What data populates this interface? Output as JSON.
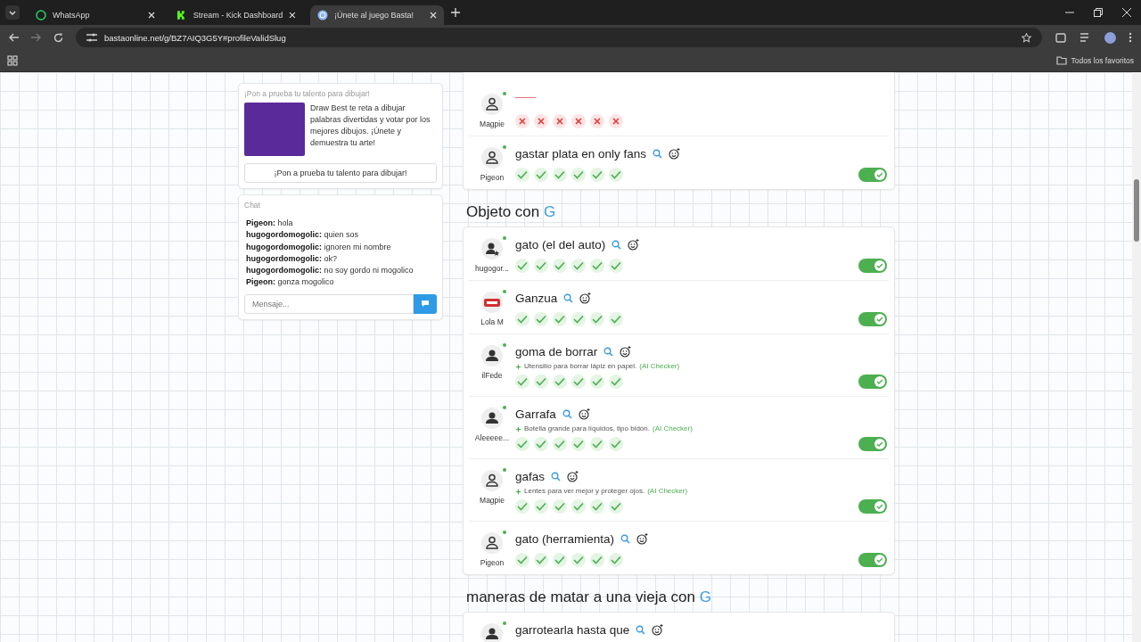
{
  "browser": {
    "tabs": [
      {
        "title": "WhatsApp",
        "kind": "chat",
        "selected": false
      },
      {
        "title": "Stream - Kick Dashboard",
        "kind": "letter",
        "selected": false
      },
      {
        "title": "¡Únete al juego Basta!",
        "kind": "globe",
        "selected": true
      }
    ],
    "url": "bastaonline.net/g/BZ7AIQ3G5Y#profileValidSlug",
    "bookmarks_label": "Todos los favoritos"
  },
  "promo": {
    "heading": "¡Pon a prueba tu talento para dibujar!",
    "text": "Draw Best te reta a dibujar palabras divertidas y votar por los mejores dibujos. ¡Únete y demuestra tu arte!",
    "button": "¡Pon a prueba tu talento para dibujar!"
  },
  "chat": {
    "title": "Chat",
    "messages": [
      {
        "user": "Pigeon:",
        "text": "hola"
      },
      {
        "user": "hugogordomogolic:",
        "text": "quien sos"
      },
      {
        "user": "hugogordomogolic:",
        "text": "ignoren mi nombre"
      },
      {
        "user": "hugogordomogolic:",
        "text": "ok?"
      },
      {
        "user": "hugogordomogolic:",
        "text": "no soy gordo ni mogolico"
      },
      {
        "user": "Pigeon:",
        "text": "gonza mogolico"
      }
    ],
    "placeholder": "Mensaje..."
  },
  "sections": [
    {
      "answers": [
        {
          "user": "Magpie",
          "kind": "outline",
          "votes": [
            false,
            false,
            false,
            false,
            false,
            false
          ]
        },
        {
          "user": "Pigeon",
          "kind": "outline",
          "answer": "gastar plata en only fans",
          "votes": [
            true,
            true,
            true,
            true,
            true,
            true
          ],
          "on": true
        }
      ]
    },
    {
      "title": "Objeto con",
      "letter": "G",
      "answers": [
        {
          "user": "hugogor...",
          "kind": "star",
          "answer": "gato (el del auto)",
          "votes": [
            true,
            true,
            true,
            true,
            true,
            true
          ],
          "on": true
        },
        {
          "user": "Lola M",
          "kind": "stop",
          "answer": "Ganzua",
          "votes": [
            true,
            true,
            true,
            true,
            true,
            true
          ],
          "on": true
        },
        {
          "user": "ilFede",
          "kind": "solid",
          "answer": "goma de borrar",
          "hint": "Utensilio para borrar lápiz en papel.",
          "hint_source": "(AI Checker)",
          "votes": [
            true,
            true,
            true,
            true,
            true,
            true
          ],
          "on": true
        },
        {
          "user": "Aleeeee...",
          "kind": "solid",
          "answer": "Garrafa",
          "hint": "Botella grande para líquidos, tipo bidón.",
          "hint_source": "(AI Checker)",
          "votes": [
            true,
            true,
            true,
            true,
            true,
            true
          ],
          "on": true
        },
        {
          "user": "Magpie",
          "kind": "outline",
          "answer": "gafas",
          "hint": "Lentes para ver mejor y proteger ojos.",
          "hint_source": "(AI Checker)",
          "votes": [
            true,
            true,
            true,
            true,
            true,
            true
          ],
          "on": true
        },
        {
          "user": "Pigeon",
          "kind": "outline",
          "answer": "gato (herramienta)",
          "votes": [
            true,
            true,
            true,
            true,
            true,
            true
          ],
          "on": true
        }
      ]
    },
    {
      "title": "maneras de matar a una vieja con",
      "letter": "G",
      "answers": [
        {
          "kind": "solid",
          "answer": "garrotearla hasta que"
        }
      ]
    }
  ]
}
